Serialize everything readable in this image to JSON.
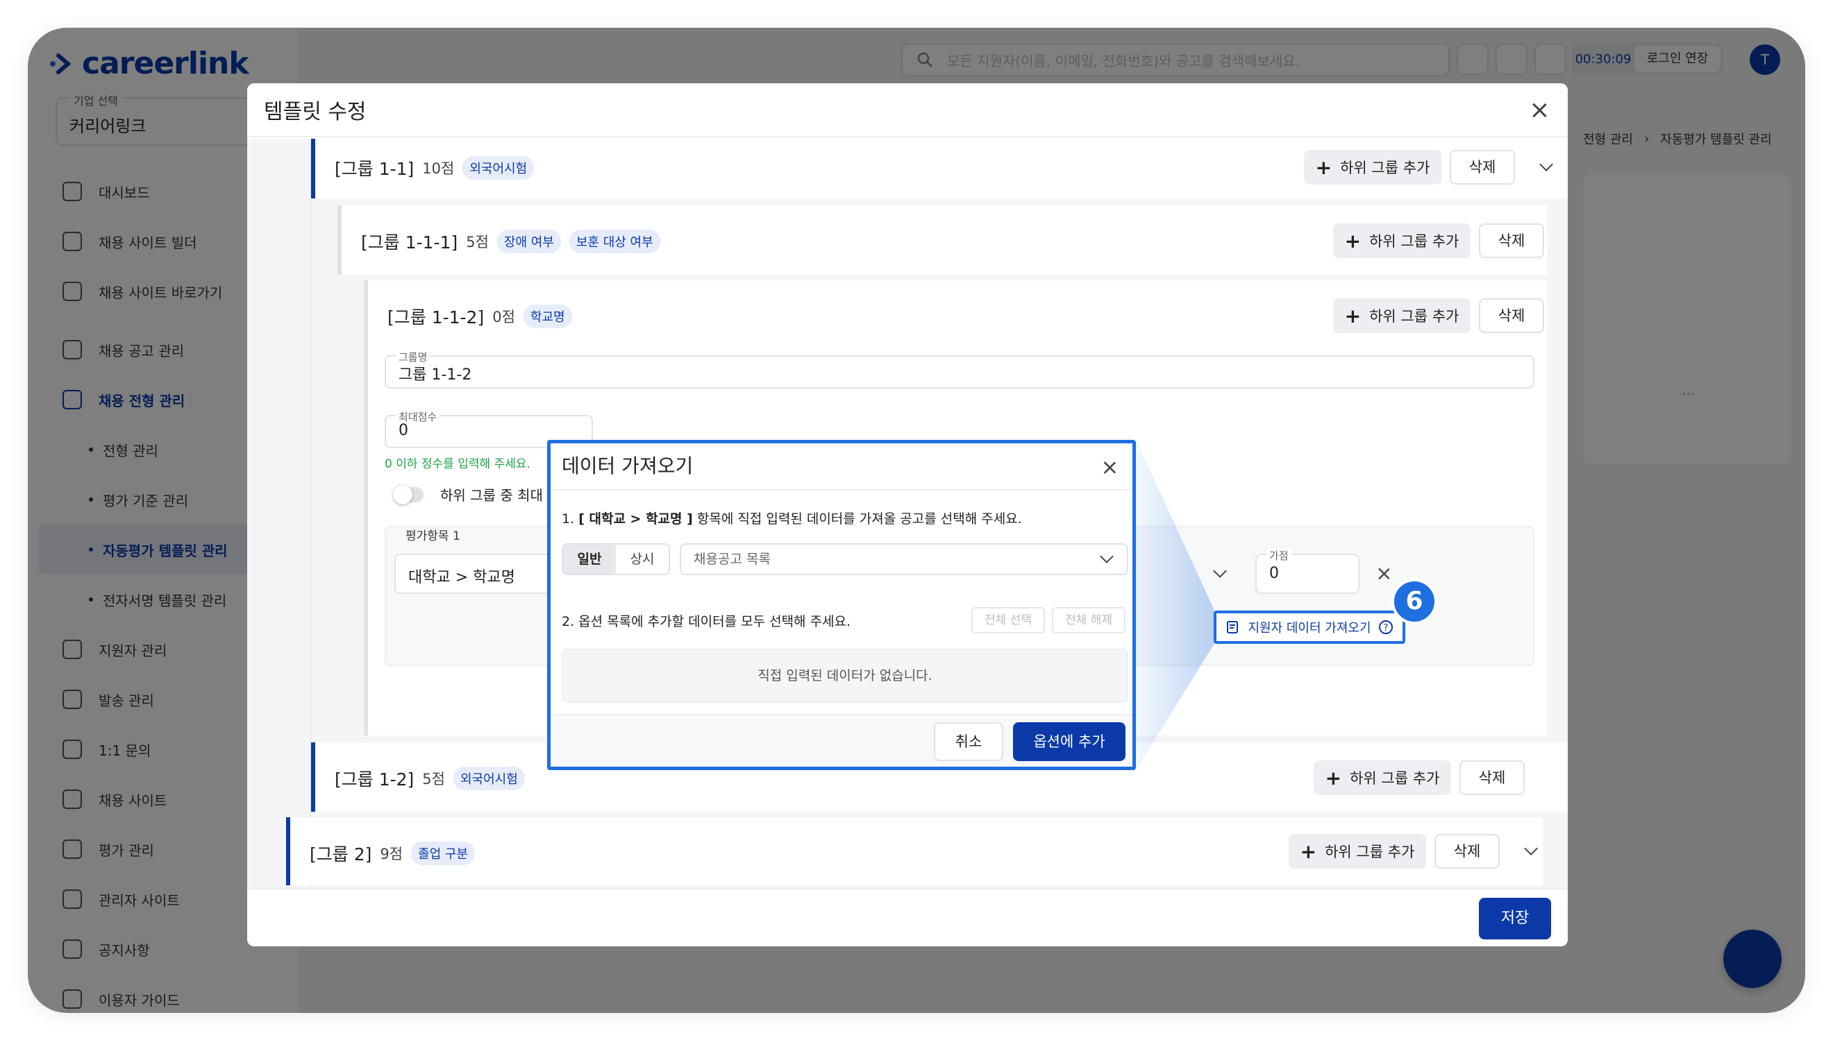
{
  "app": {
    "brand": "careerlink",
    "company_caption": "기업 선택",
    "company_value": "커리어링크",
    "search_placeholder": "모든 지원자(이름, 이메일, 전화번호)와 공고를 검색해보세요.",
    "timer": "00:30:09",
    "extend_login": "로그인 연장",
    "avatar_letter": "T"
  },
  "sidebar": {
    "items": [
      {
        "label": "대시보드",
        "icon": "dashboard-icon"
      },
      {
        "label": "채용 사이트 빌더",
        "icon": "tools-icon"
      },
      {
        "label": "채용 사이트 바로가기",
        "icon": "home-icon"
      },
      {
        "label": "채용 공고 관리",
        "icon": "list-icon"
      },
      {
        "label": "채용 전형 관리",
        "icon": "clipboard-icon"
      },
      {
        "label": "지원자 관리",
        "icon": "users-icon"
      },
      {
        "label": "발송 관리",
        "icon": "mail-icon"
      },
      {
        "label": "1:1 문의",
        "icon": "chat-icon"
      },
      {
        "label": "채용 사이트",
        "icon": "calendar-icon"
      },
      {
        "label": "평가 관리",
        "icon": "ab-icon"
      },
      {
        "label": "관리자 사이트",
        "icon": "admin-home-icon"
      }
    ],
    "sub_items": [
      "전형 관리",
      "평가 기준 관리",
      "자동평가 템플릿 관리",
      "전자서명 템플릿 관리"
    ],
    "footer": [
      {
        "label": "공지사항",
        "icon": "megaphone-icon"
      },
      {
        "label": "이용자 가이드",
        "icon": "help-icon"
      }
    ]
  },
  "breadcrumb": {
    "items": [
      "전형 관리",
      "자동평가 템플릿 관리"
    ],
    "more": "..."
  },
  "modal": {
    "title": "템플릿 수정",
    "add_sub_group": "하위 그룹 추가",
    "delete": "삭제",
    "save": "저장",
    "groups": [
      {
        "name": "[그룹 1-1]",
        "score": "10점",
        "tags": [
          "외국어시험"
        ]
      },
      {
        "name": "[그룹 1-1-1]",
        "score": "5점",
        "tags": [
          "장애 여부",
          "보훈 대상 여부"
        ]
      },
      {
        "name": "[그룹 1-1-2]",
        "score": "0점",
        "tags": [
          "학교명"
        ]
      },
      {
        "name": "[그룹 1-2]",
        "score": "5점",
        "tags": [
          "외국어시험"
        ]
      },
      {
        "name": "[그룹 2]",
        "score": "9점",
        "tags": [
          "졸업 구분"
        ]
      }
    ],
    "expanded": {
      "group_name_caption": "그룹명",
      "group_name_value": "그룹 1-1-2",
      "max_score_caption": "최대점수",
      "max_score_value": "0",
      "max_score_hint": "0 이하 정수를 입력해 주세요.",
      "toggle_label": "하위 그룹 중 최대 점",
      "eval_item_caption": "평가항목 1",
      "eval_item_value": "대학교 > 학교명",
      "bonus_caption": "가점",
      "bonus_value": "0",
      "import_button": "지원자 데이터 가져오기"
    }
  },
  "dialog": {
    "title": "데이터 가져오기",
    "step1_prefix": "1.",
    "step1_bold": "[ 대학교 > 학교명 ]",
    "step1_rest": "항목에 직접 입력된 데이터를 가져올 공고를 선택해 주세요.",
    "seg_options": [
      "일반",
      "상시"
    ],
    "seg_selected": "일반",
    "select_value": "채용공고 목록",
    "step2": "2. 옵션 목록에 추가할 데이터를 모두 선택해 주세요.",
    "select_all": "전체 선택",
    "deselect_all": "전체 해제",
    "empty_text": "직접 입력된 데이터가 없습니다.",
    "cancel": "취소",
    "confirm": "옵션에 추가"
  },
  "annotation": {
    "step_number": "6"
  },
  "colors": {
    "brand": "#0b3aa8",
    "highlight": "#1e6fe0",
    "tag_bg": "#e6ecfa",
    "success": "#1aa34a"
  }
}
